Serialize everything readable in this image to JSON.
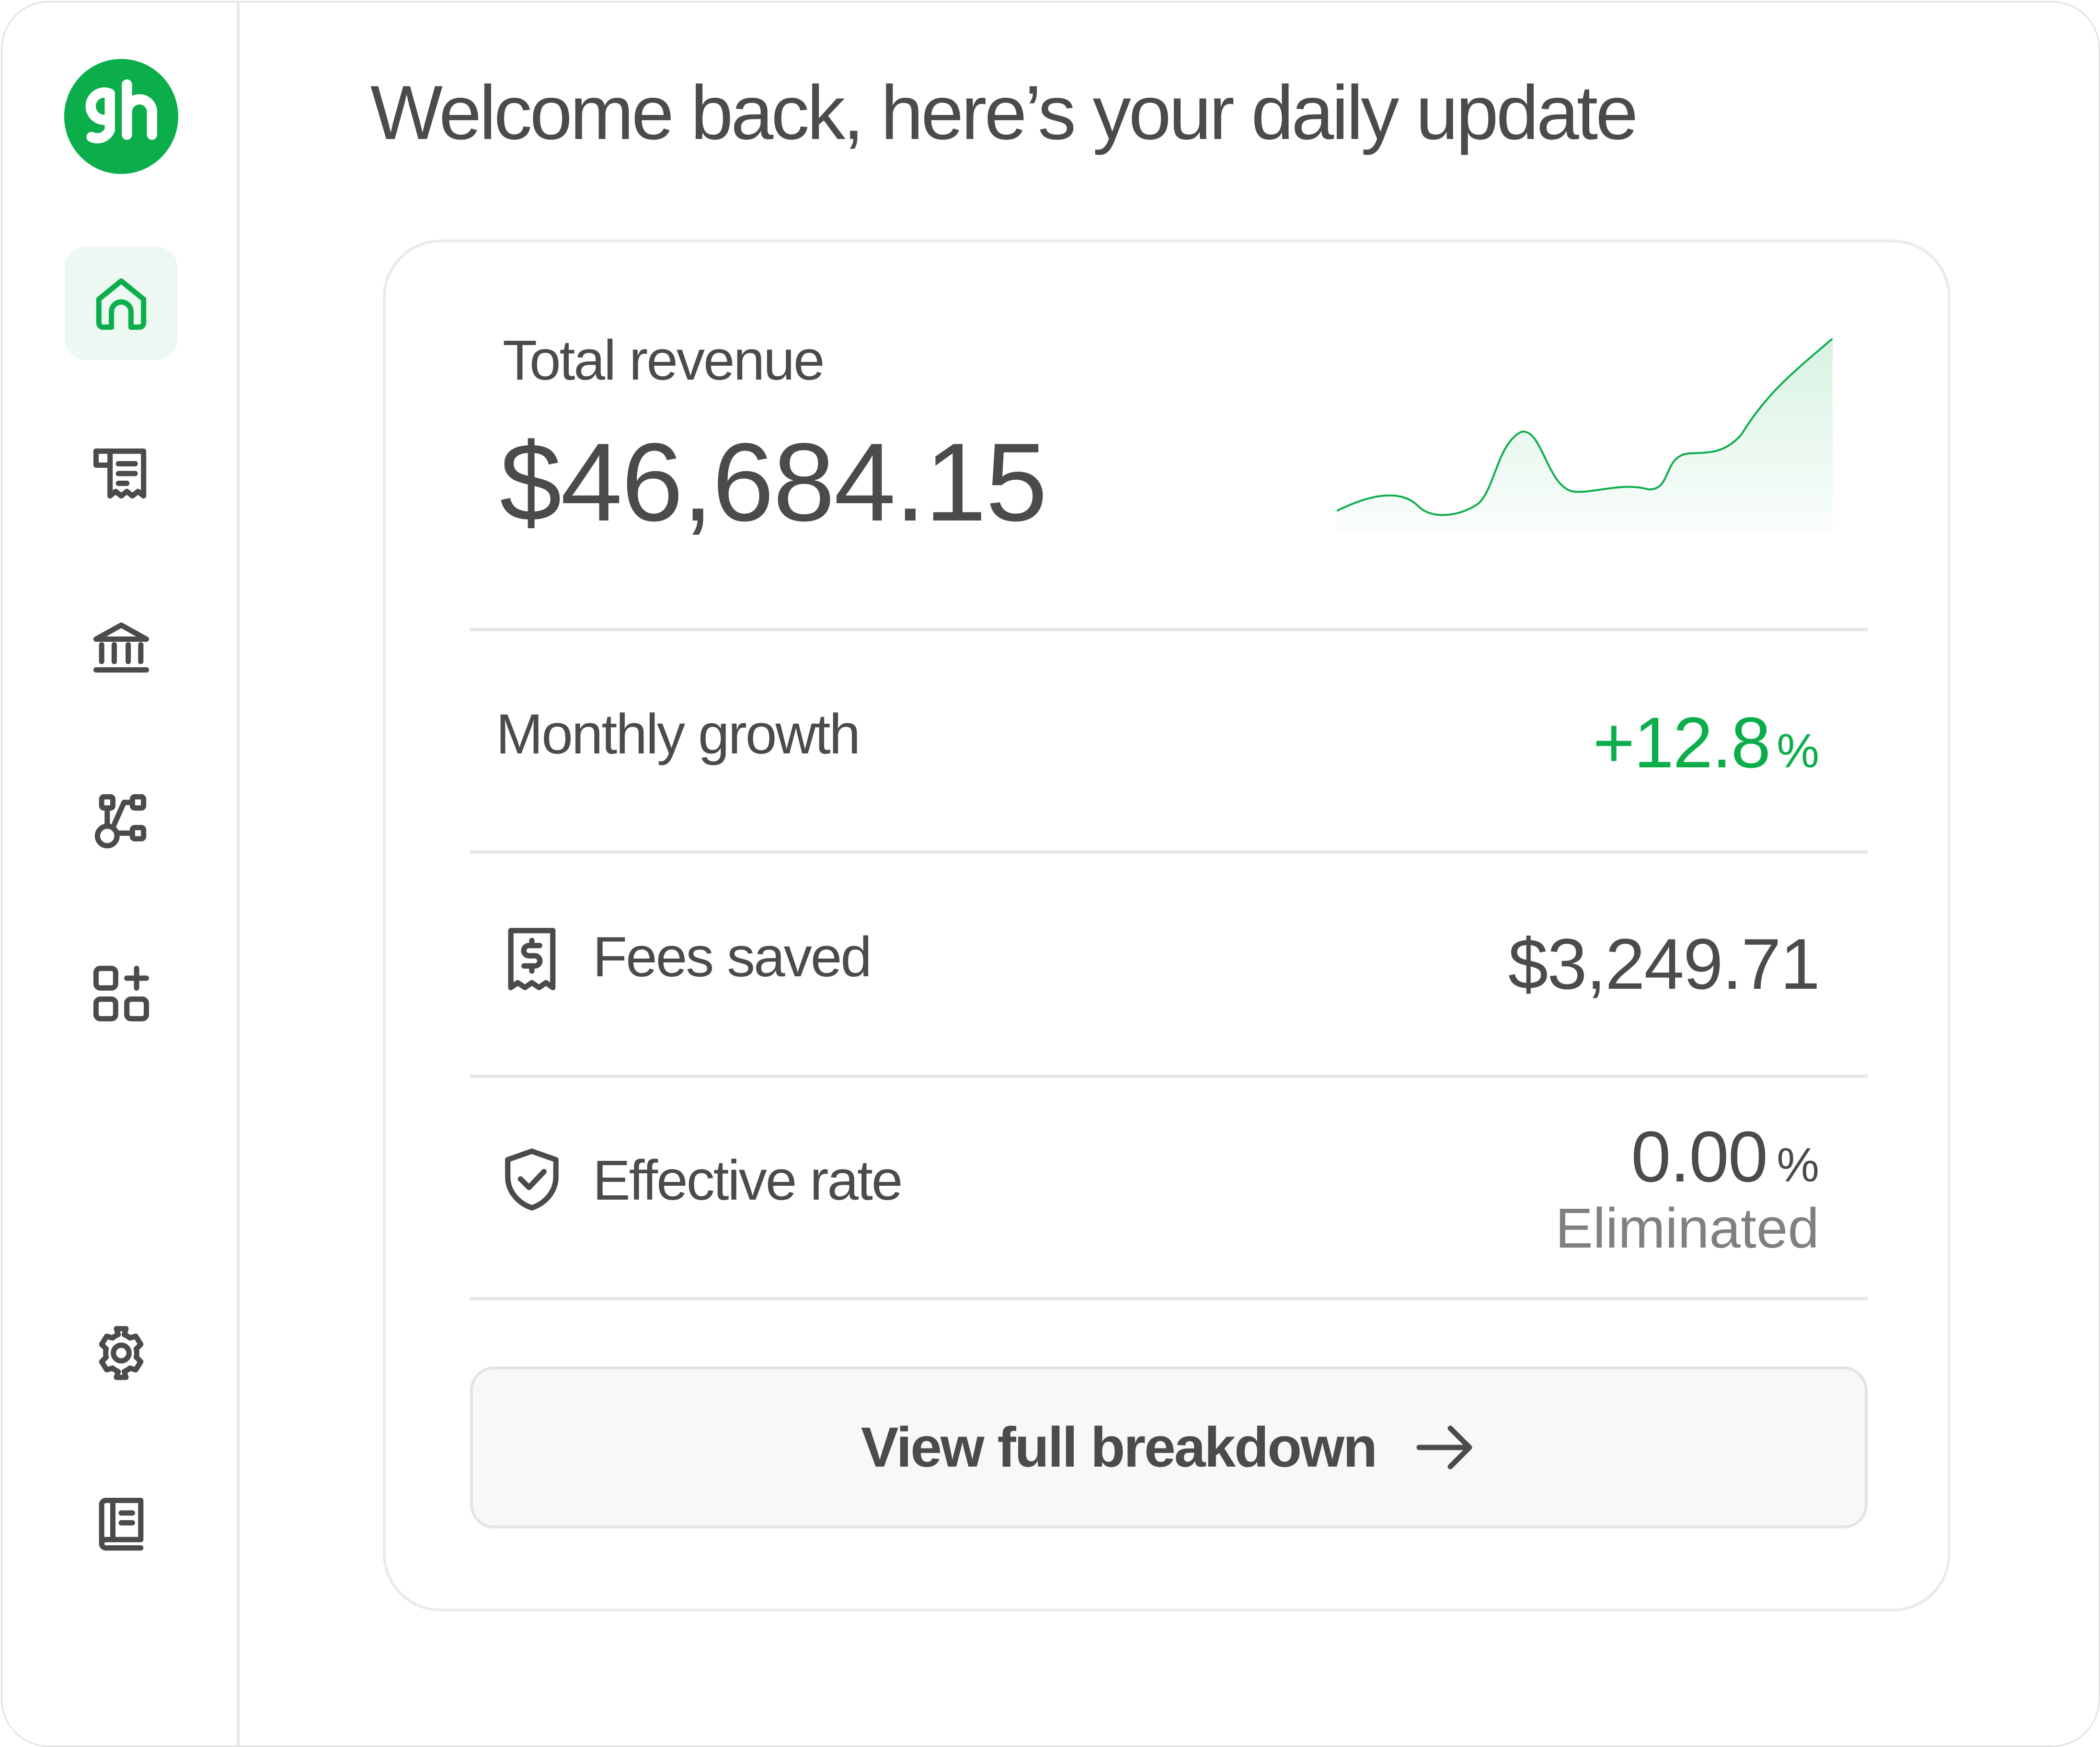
{
  "app": {
    "logo_icon": "gh-logo-icon",
    "brand_color": "#0cae4b"
  },
  "sidebar": {
    "items": [
      {
        "icon": "home-icon",
        "active": true
      },
      {
        "icon": "receipt-icon",
        "active": false
      },
      {
        "icon": "bank-icon",
        "active": false
      },
      {
        "icon": "workflow-icon",
        "active": false
      },
      {
        "icon": "apps-add-icon",
        "active": false
      },
      {
        "icon": "gear-icon",
        "active": false
      },
      {
        "icon": "book-icon",
        "active": false
      }
    ]
  },
  "header": {
    "title": "Welcome back, here’s your daily update"
  },
  "revenue": {
    "label": "Total revenue",
    "value": "$46,684.15",
    "sparkline_color": "#0cae4b"
  },
  "metrics": {
    "growth": {
      "label": "Monthly growth",
      "value": "+12.8",
      "unit": "%",
      "color": "#0cae4b"
    },
    "fees": {
      "icon": "receipt-dollar-icon",
      "label": "Fees saved",
      "value": "$3,249.71"
    },
    "rate": {
      "icon": "shield-check-icon",
      "label": "Effective rate",
      "value": "0.00",
      "unit": "%",
      "sublabel": "Eliminated"
    }
  },
  "breakdown_button": {
    "label": "View full breakdown",
    "icon": "arrow-right-icon"
  }
}
